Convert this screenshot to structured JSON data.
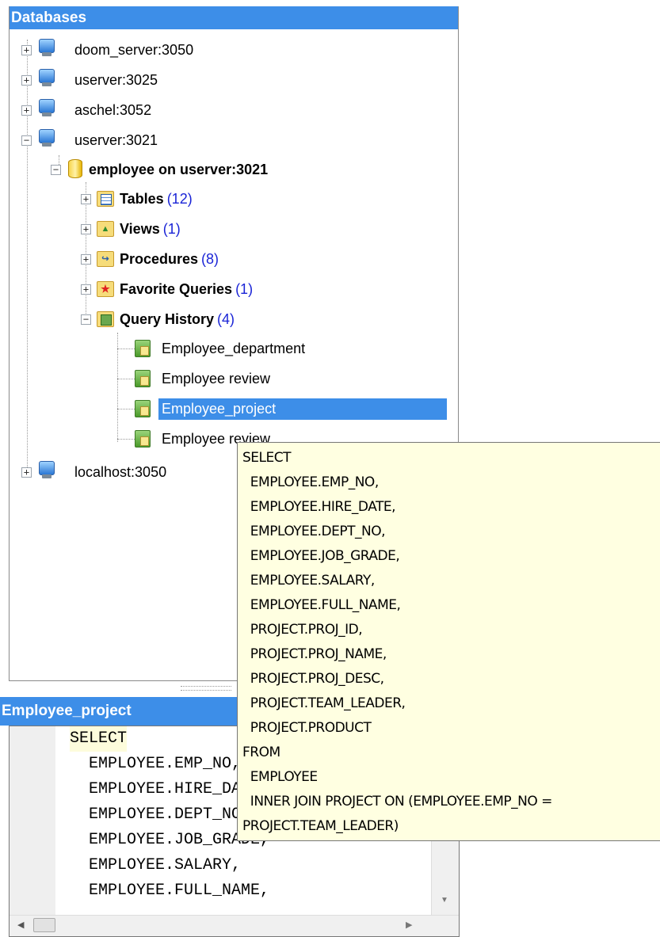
{
  "databases_panel": {
    "title": "Databases",
    "servers": [
      {
        "label": "doom_server:3050"
      },
      {
        "label": "userver:3025"
      },
      {
        "label": "aschel:3052"
      },
      {
        "label": "userver:3021"
      },
      {
        "label": "localhost:3050"
      }
    ],
    "database": {
      "label": "employee on userver:3021"
    },
    "groups": [
      {
        "label": "Tables",
        "count": "(12)"
      },
      {
        "label": "Views",
        "count": "(1)"
      },
      {
        "label": "Procedures",
        "count": "(8)"
      },
      {
        "label": "Favorite Queries",
        "count": "(1)"
      },
      {
        "label": "Query History",
        "count": "(4)"
      }
    ],
    "history_items": [
      {
        "label": "Employee_department"
      },
      {
        "label": "Employee review"
      },
      {
        "label": "Employee_project"
      },
      {
        "label": "Employee review"
      }
    ],
    "expanders": {
      "plus": "+",
      "minus": "−"
    }
  },
  "sql_panel": {
    "title": "Employee_project",
    "lines": [
      "SELECT",
      "  EMPLOYEE.EMP_NO,",
      "  EMPLOYEE.HIRE_DATE,",
      "  EMPLOYEE.DEPT_NO,",
      "  EMPLOYEE.JOB_GRADE,",
      "  EMPLOYEE.SALARY,",
      "  EMPLOYEE.FULL_NAME,"
    ]
  },
  "tooltip": {
    "lines": [
      "SELECT",
      "  EMPLOYEE.EMP_NO,",
      "  EMPLOYEE.HIRE_DATE,",
      "  EMPLOYEE.DEPT_NO,",
      "  EMPLOYEE.JOB_GRADE,",
      "  EMPLOYEE.SALARY,",
      "  EMPLOYEE.FULL_NAME,",
      "  PROJECT.PROJ_ID,",
      "  PROJECT.PROJ_NAME,",
      "  PROJECT.PROJ_DESC,",
      "  PROJECT.TEAM_LEADER,",
      "  PROJECT.PRODUCT",
      "FROM",
      "  EMPLOYEE",
      "  INNER JOIN PROJECT ON (EMPLOYEE.EMP_NO =",
      "PROJECT.TEAM_LEADER)"
    ]
  },
  "icons": {
    "server": "server-monitor-icon",
    "database": "database-cylinder-icon",
    "tables": "table-grid-icon",
    "views": "view-tree-icon",
    "procedures": "procedure-icon",
    "favorites": "star-icon",
    "history": "history-notebook-icon",
    "query": "query-icon"
  },
  "colors": {
    "header": "#3d8ee8",
    "selection": "#3d8ee8",
    "count": "#1a24d6",
    "tooltip_bg": "#ffffe1"
  },
  "scroll": {
    "down": "▼",
    "left": "◀",
    "right": "▶"
  }
}
